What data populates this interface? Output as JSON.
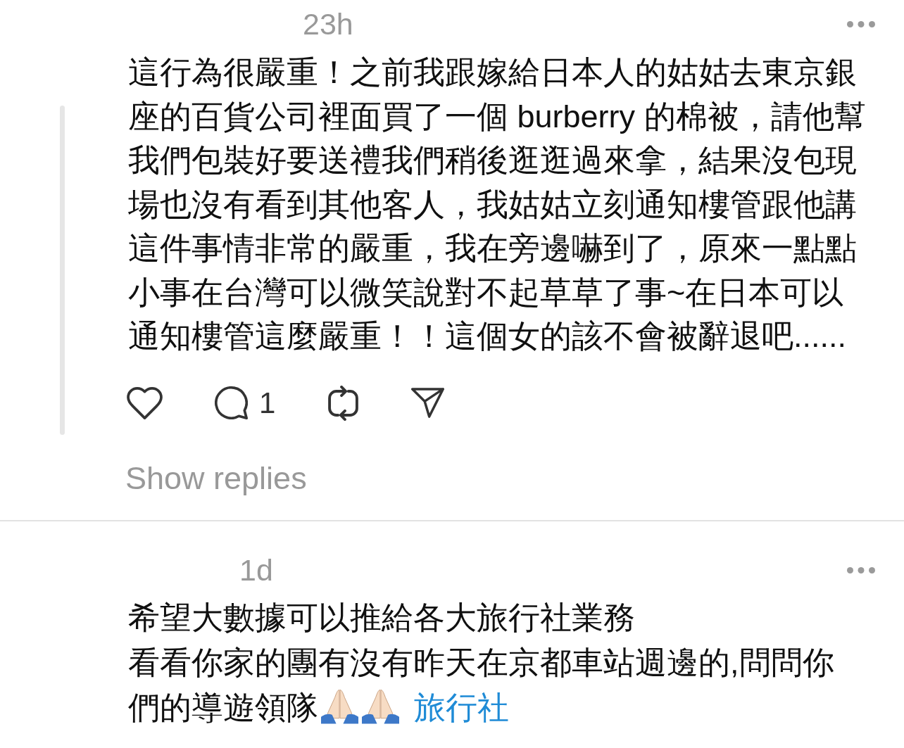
{
  "comments": [
    {
      "time": "23h",
      "thread_line": true,
      "paragraphs": [
        [
          {
            "kind": "text",
            "text": "這行為很嚴重！之前我跟嫁給日本人的姑姑去東京銀座的百貨公司裡面買了一個 burberry 的棉被，請他幫我們包裝好要送禮我們稍後逛逛過來拿，結果沒包現場也沒有看到其他客人，我姑姑立刻通知樓管跟他講這件事情非常的嚴重，我在旁邊嚇到了，原來一點點小事在台灣可以微笑說對不起草草了事~在日本可以通知樓管這麼嚴重！！這個女的該不會被辭退吧......"
          }
        ]
      ],
      "actions": [
        {
          "kind": "like"
        },
        {
          "kind": "reply",
          "count": "1"
        },
        {
          "kind": "repost"
        },
        {
          "kind": "share"
        }
      ],
      "show_replies": "Show replies"
    },
    {
      "time": "1d",
      "paragraphs": [
        [
          {
            "kind": "text",
            "text": "希望大數據可以推給各大旅行社業務"
          }
        ],
        [
          {
            "kind": "text",
            "text": "看看你家的團有沒有昨天在京都車站週邊的,問問你們的導遊領隊"
          },
          {
            "kind": "emoji"
          },
          {
            "kind": "emoji"
          },
          {
            "kind": "tag",
            "text": "旅行社"
          }
        ]
      ]
    }
  ]
}
